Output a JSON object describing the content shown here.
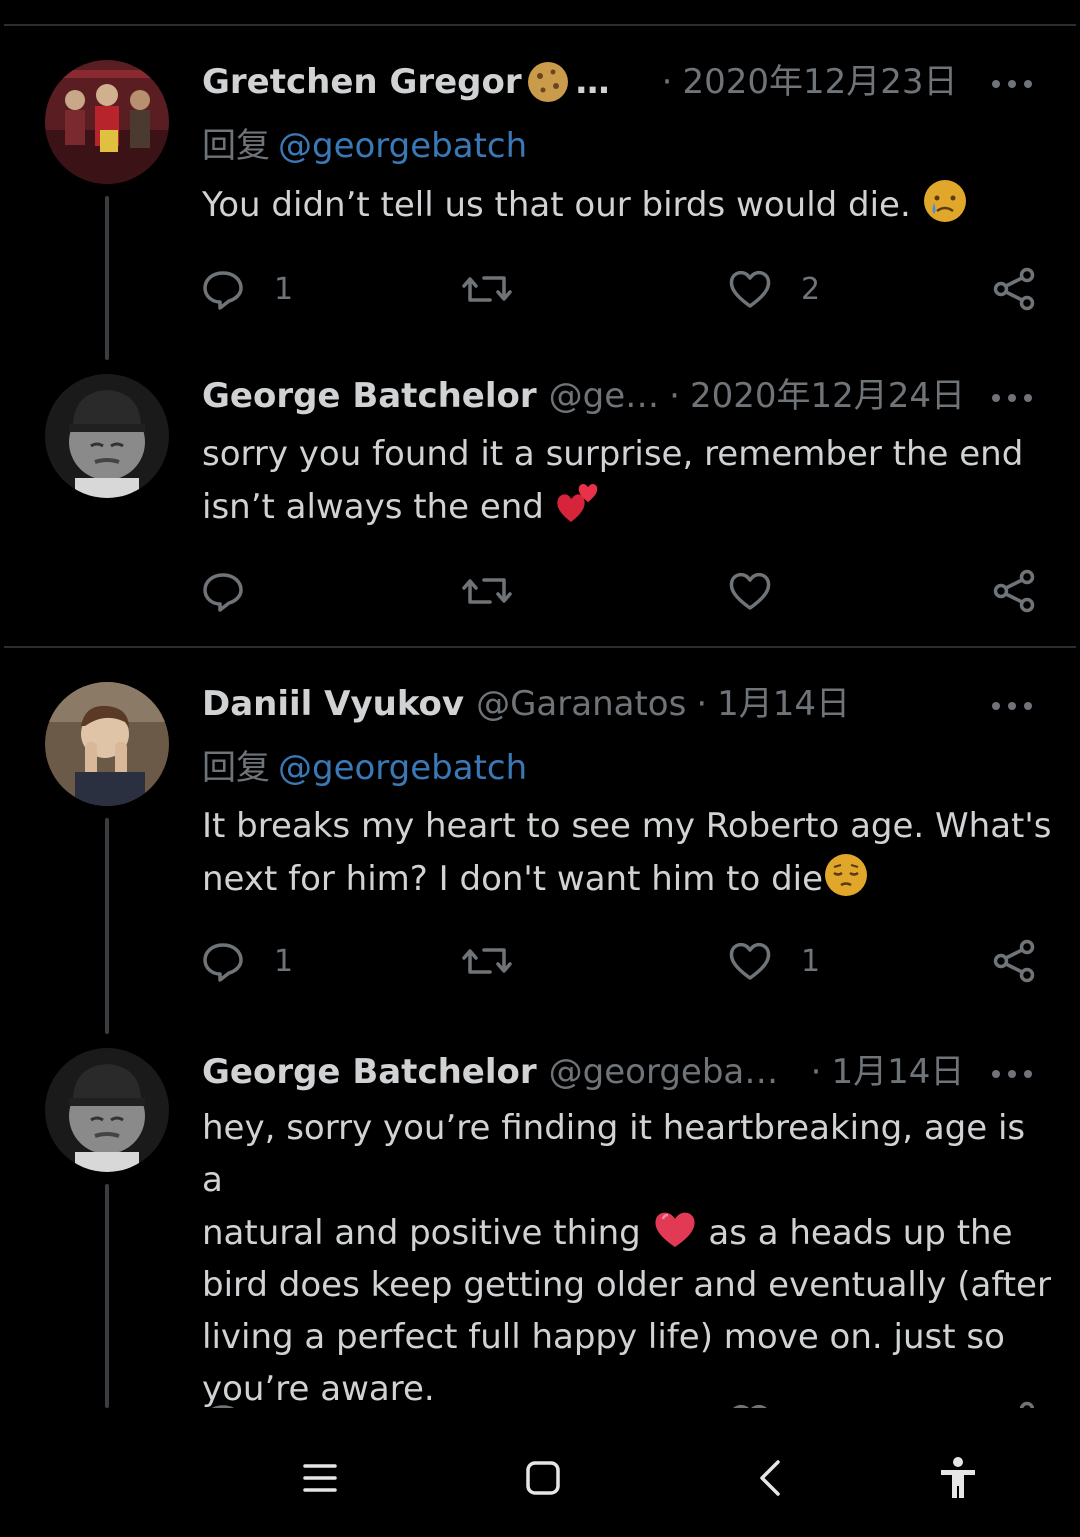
{
  "colors": {
    "background": "#000000",
    "text": "#d0d2d4",
    "muted": "#6f7479",
    "mention": "#3a79b6",
    "divider": "#2b2e31"
  },
  "tweets": [
    {
      "name": "Gretchen Gregor",
      "name_suffix": "…",
      "handle": "",
      "date": "2020年12月23日",
      "reply_label": "回复",
      "reply_mention": "@georgebatch",
      "text": "You didn’t tell us that our birds would die. ",
      "emoji": "crying-face",
      "reply_count": "1",
      "like_count": "2"
    },
    {
      "name": "George Batchelor",
      "handle": "@ge…",
      "date": "2020年12月24日",
      "text_line1": "sorry you found it a surprise, remember the end",
      "text_line2": "isn’t always the end ",
      "emoji": "two-hearts",
      "reply_count": "",
      "like_count": ""
    },
    {
      "name": "Daniil Vyukov",
      "handle": "@Garanatos",
      "date": "1月14日",
      "reply_label": "回复",
      "reply_mention": "@georgebatch",
      "text_line1": "It breaks my heart to see my Roberto age. What's",
      "text_line2": "next for him? I don't want him to die",
      "emoji": "pensive-face",
      "reply_count": "1",
      "like_count": "1"
    },
    {
      "name": "George Batchelor",
      "handle": "@georgebat…",
      "date": "1月14日",
      "text_line1": "hey, sorry you’re finding it heartbreaking, age is a",
      "text_line2a": "natural and positive thing ",
      "text_line2b": " as a heads up the",
      "text_line3": "bird does keep getting older and eventually (after",
      "text_line4": "living a perfect full happy life) move on. just so",
      "text_line5": "you’re aware.",
      "emoji": "red-heart"
    }
  ],
  "separator": "·"
}
